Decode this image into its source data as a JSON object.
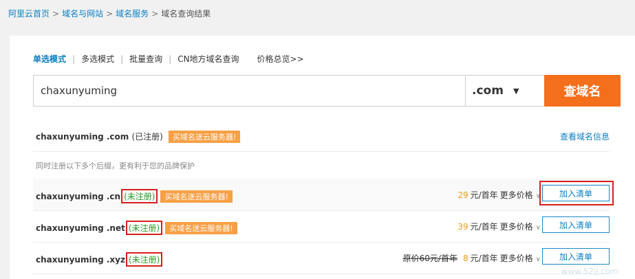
{
  "breadcrumb": {
    "items": [
      "阿里云首页",
      "域名与网站",
      "域名服务"
    ],
    "separator": ">",
    "current": "域名查询结果"
  },
  "tabs": {
    "items": [
      "单选模式",
      "多选模式",
      "批量查询",
      "CN地方域名查询"
    ],
    "active_index": 0,
    "price_link": "价格总览>>"
  },
  "search": {
    "query": "chaxunyuming",
    "tld": ".com",
    "button": "查域名"
  },
  "registered": {
    "domain": "chaxunyuming .com",
    "status": "(已注册)",
    "promo": "买域名送云服务器!",
    "link": "查看域名信息"
  },
  "note": "同时注册以下多个后缀，更有利于您的品牌保护",
  "rows": [
    {
      "domain": "chaxunyuming .cn",
      "status": "(未注册)",
      "promo": "买域名送云服务器!",
      "original_price": "",
      "price": "29",
      "unit": "元/首年",
      "more": "更多价格",
      "button": "加入清单"
    },
    {
      "domain": "chaxunyuming .net",
      "status": "(未注册)",
      "promo": "买域名送云服务器!",
      "original_price": "",
      "price": "39",
      "unit": "元/首年",
      "more": "更多价格",
      "button": "加入清单"
    },
    {
      "domain": "chaxunyuming .xyz",
      "status": "(未注册)",
      "promo": "",
      "original_price": "原价60元/首年",
      "price": "8",
      "unit": "元/首年",
      "more": "更多价格",
      "button": "加入清单"
    }
  ],
  "watermark": "www.52ij.com",
  "colors": {
    "link": "#0a7fc4",
    "search_button": "#f36f1c",
    "promo_bg": "#f7a045",
    "price": "#f39a1c",
    "available": "#2a9d2a",
    "highlight": "#d81e1e"
  }
}
